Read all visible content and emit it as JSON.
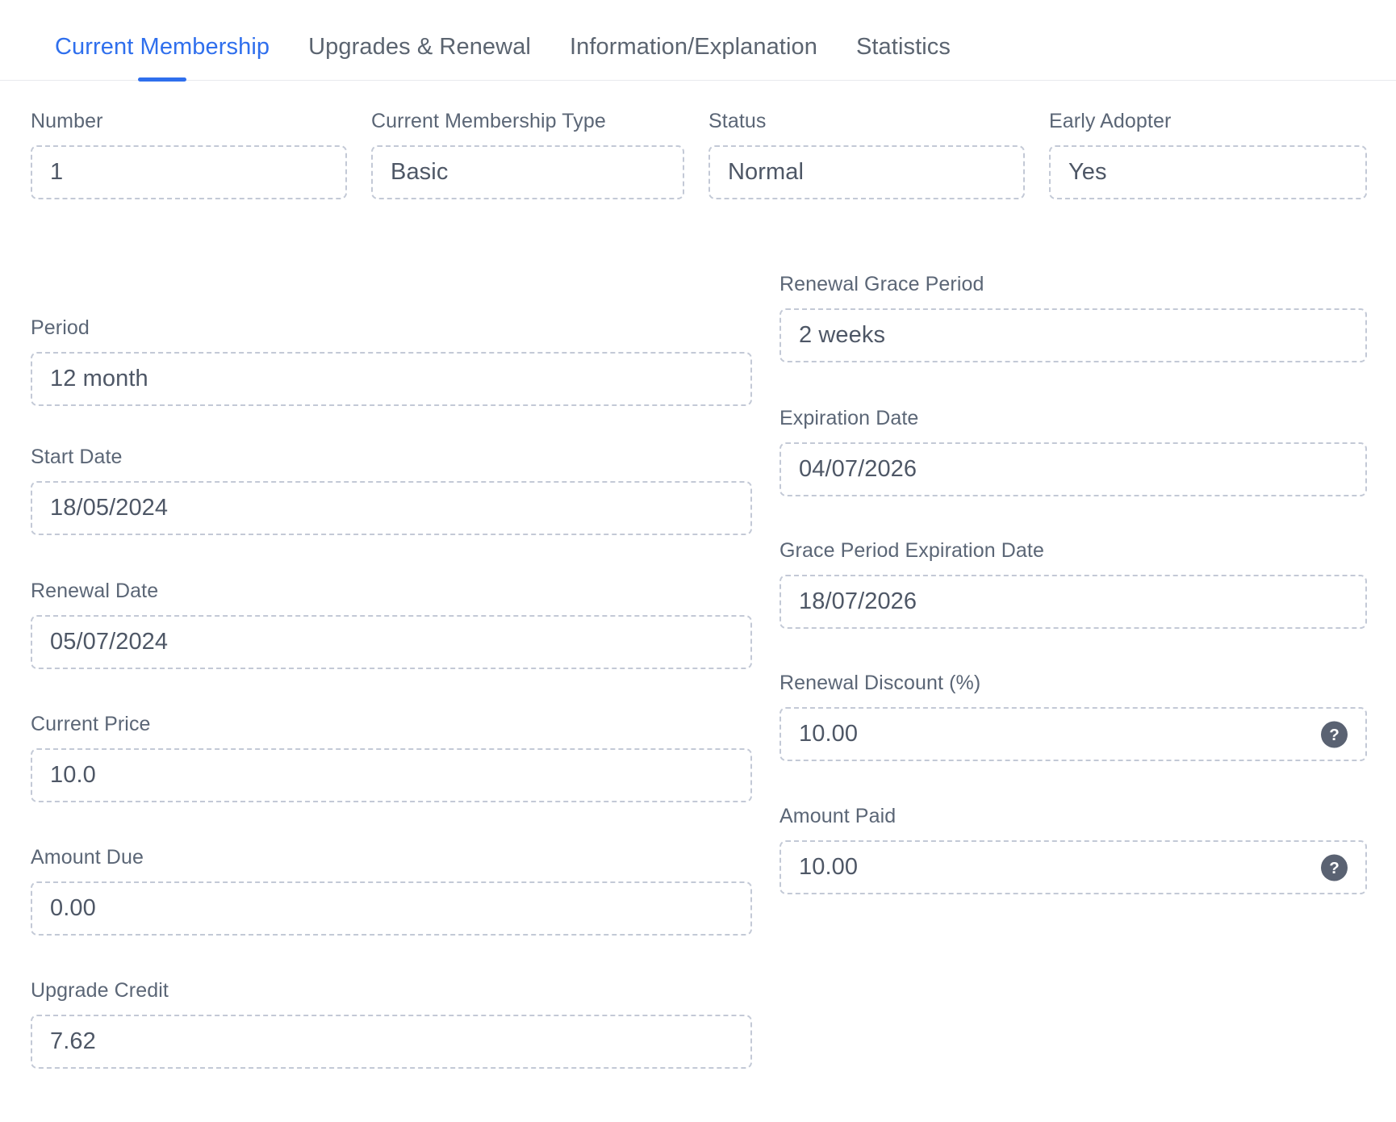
{
  "tabs": [
    {
      "label": "Current Membership",
      "active": true
    },
    {
      "label": "Upgrades & Renewal",
      "active": false
    },
    {
      "label": "Information/Explanation",
      "active": false
    },
    {
      "label": "Statistics",
      "active": false
    }
  ],
  "top_row": {
    "number": {
      "label": "Number",
      "value": "1"
    },
    "type": {
      "label": "Current Membership Type",
      "value": "Basic"
    },
    "status": {
      "label": "Status",
      "value": "Normal"
    },
    "early": {
      "label": "Early Adopter",
      "value": "Yes"
    }
  },
  "left_column": {
    "period": {
      "label": "Period",
      "value": "12 month"
    },
    "start_date": {
      "label": "Start Date",
      "value": "18/05/2024"
    },
    "renewal_date": {
      "label": "Renewal Date",
      "value": "05/07/2024"
    },
    "current_price": {
      "label": "Current Price",
      "value": "10.0"
    },
    "amount_due": {
      "label": "Amount Due",
      "value": "0.00"
    },
    "upgrade_credit": {
      "label": "Upgrade Credit",
      "value": "7.62"
    }
  },
  "right_column": {
    "grace_period": {
      "label": "Renewal Grace Period",
      "value": "2 weeks"
    },
    "expiration": {
      "label": "Expiration Date",
      "value": "04/07/2026"
    },
    "grace_expiration": {
      "label": "Grace Period Expiration Date",
      "value": "18/07/2026"
    },
    "renewal_discount": {
      "label": "Renewal Discount (%)",
      "value": "10.00",
      "help": "help-icon"
    },
    "amount_paid": {
      "label": "Amount Paid",
      "value": "10.00",
      "help": "help-icon"
    }
  },
  "colors": {
    "accent": "#2f6fed",
    "label": "#5b6676",
    "value": "#4e5766",
    "field_border": "#c3c9d6",
    "help_bg": "#5a6272",
    "background": "#ffffff"
  }
}
